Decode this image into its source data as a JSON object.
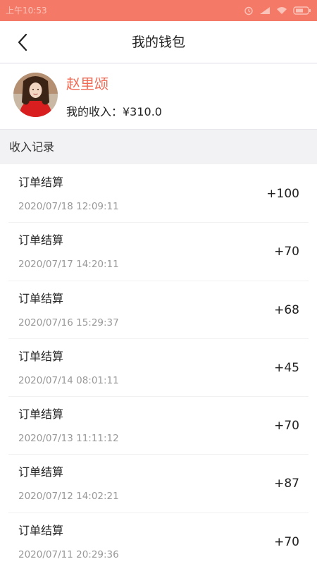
{
  "status_bar": {
    "time": "上午10:53",
    "background_color": "#f47a67"
  },
  "nav": {
    "back_icon": "chevron-left-icon",
    "title": "我的钱包"
  },
  "profile": {
    "avatar": "user-avatar",
    "name": "赵里颂",
    "name_color": "#f06a55",
    "income": "我的收入：¥310.0"
  },
  "records": {
    "header": "收入记录",
    "items": [
      {
        "title": "订单结算",
        "time": "2020/07/18 12:09:11",
        "amount": "+100"
      },
      {
        "title": "订单结算",
        "time": "2020/07/17 14:20:11",
        "amount": "+70"
      },
      {
        "title": "订单结算",
        "time": "2020/07/16 15:29:37",
        "amount": "+68"
      },
      {
        "title": "订单结算",
        "time": "2020/07/14 08:01:11",
        "amount": "+45"
      },
      {
        "title": "订单结算",
        "time": "2020/07/13 11:11:12",
        "amount": "+70"
      },
      {
        "title": "订单结算",
        "time": "2020/07/12 14:02:21",
        "amount": "+87"
      },
      {
        "title": "订单结算",
        "time": "2020/07/11 20:29:36",
        "amount": "+70"
      }
    ]
  }
}
